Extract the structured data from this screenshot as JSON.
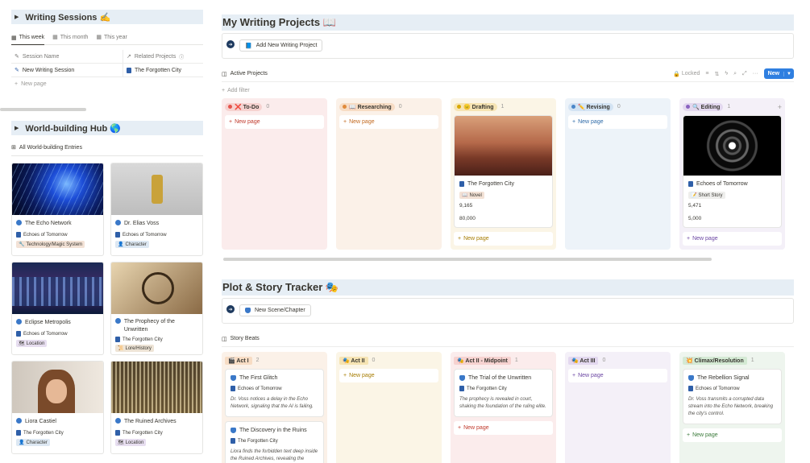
{
  "writing_sessions": {
    "title": "Writing Sessions ✍️",
    "tabs": [
      {
        "label": "This week",
        "icon": "▦"
      },
      {
        "label": "This month",
        "icon": "▦"
      },
      {
        "label": "This year",
        "icon": "▦"
      }
    ],
    "columns": [
      "Session Name",
      "Related Projects"
    ],
    "rows": [
      {
        "name": "New Writing Session",
        "project": "The Forgotten City"
      }
    ],
    "new_page": "New page"
  },
  "world_hub": {
    "title": "World-building Hub 🌎",
    "view_label": "All World-building Entries",
    "cards": [
      {
        "title": "The Echo Network",
        "project": "Echoes of Tomorrow",
        "tag": "Technology/Magic System",
        "tag_icon": "🔧"
      },
      {
        "title": "Dr. Elias Voss",
        "project": "Echoes of Tomorrow",
        "tag": "Character",
        "tag_icon": "👤"
      },
      {
        "title": "Eclipse Metropolis",
        "project": "Echoes of Tomorrow",
        "tag": "Location",
        "tag_icon": "🗺"
      },
      {
        "title": "The Prophecy of the Unwritten",
        "project": "The Forgotten City",
        "tag": "Lore/History",
        "tag_icon": "📜"
      },
      {
        "title": "Liora Castiel",
        "project": "The Forgotten City",
        "tag": "Character",
        "tag_icon": "👤"
      },
      {
        "title": "The Ruined Archives",
        "project": "The Forgotten City",
        "tag": "Location",
        "tag_icon": "🗺"
      }
    ]
  },
  "projects": {
    "title": "My Writing Projects 📖",
    "add_button": "Add New Writing Project",
    "db_title": "Active Projects",
    "locked": "Locked",
    "new_label": "New",
    "add_filter": "Add filter",
    "new_page": "New page",
    "columns": [
      {
        "status": "❌ To-Do",
        "count": "0",
        "bg": "#fbecec",
        "pill": "#f6d2d0",
        "dot": "#e5534b",
        "color": "#c0392b"
      },
      {
        "status": "📖 Researching",
        "count": "0",
        "bg": "#fbf1e8",
        "pill": "#f7dcc4",
        "dot": "#e08a3b",
        "color": "#c2691f"
      },
      {
        "status": "😐 Drafting",
        "count": "1",
        "bg": "#fbf5e6",
        "pill": "#f6e4b3",
        "dot": "#d9a800",
        "color": "#a67c00"
      },
      {
        "status": "✏️ Revising",
        "count": "0",
        "bg": "#edf3f9",
        "pill": "#d3e3f3",
        "dot": "#4a86c8",
        "color": "#2d6aa8"
      },
      {
        "status": "🔍 Editing",
        "count": "1",
        "bg": "#f4f0f8",
        "pill": "#e3d8ef",
        "dot": "#8a63c0",
        "color": "#6b46a3"
      }
    ],
    "cards": {
      "drafting": {
        "title": "The Forgotten City",
        "type": "Novel",
        "words": "9,165",
        "goal": "80,000"
      },
      "editing": {
        "title": "Echoes of Tomorrow",
        "type": "Short Story",
        "words": "5,471",
        "goal": "5,000"
      }
    }
  },
  "plot": {
    "title": "Plot & Story Tracker 🎭",
    "add_button": "New Scene/Chapter",
    "db_title": "Story Beats",
    "new_page": "New page",
    "columns": [
      {
        "label": "🎬 Act I",
        "count": "2",
        "bg": "#fbf1e8",
        "pill": "#f7dcc4"
      },
      {
        "label": "🎭 Act II",
        "count": "0",
        "bg": "#fbf5e6",
        "pill": "#f6e4b3"
      },
      {
        "label": "🎭 Act II - Midpoint",
        "count": "1",
        "bg": "#fbecec",
        "pill": "#f6d2d0"
      },
      {
        "label": "🎭 Act III",
        "count": "0",
        "bg": "#f4f0f8",
        "pill": "#e3d8ef"
      },
      {
        "label": "💥 Climax/Resolution",
        "count": "1",
        "bg": "#eef5ee",
        "pill": "#d4ead4"
      }
    ],
    "cards": {
      "a1": {
        "title": "The First Glitch",
        "project": "Echoes of Tomorrow",
        "desc": "Dr. Voss notices a delay in the Echo Network, signaling that the AI is failing."
      },
      "a2": {
        "title": "The Discovery in the Ruins",
        "project": "The Forgotten City",
        "desc": "Liora finds the forbidden text deep inside the Ruined Archives, revealing the"
      },
      "mid": {
        "title": "The Trial of the Unwritten",
        "project": "The Forgotten City",
        "desc": "The prophecy is revealed in court, shaking the foundation of the ruling elite."
      },
      "climax": {
        "title": "The Rebellion Signal",
        "project": "Echoes of Tomorrow",
        "desc": "Dr. Voss transmits a corrupted data stream into the Echo Network, breaking the city's control."
      }
    }
  }
}
